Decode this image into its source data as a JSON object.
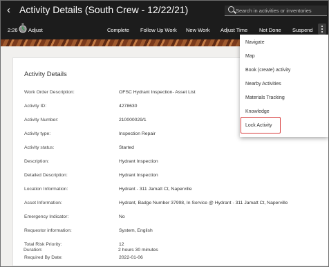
{
  "header": {
    "back_glyph": "‹",
    "title": "Activity Details (South Crew - 12/22/21)",
    "search_placeholder": "Search in activities or inventories",
    "time": "2:26",
    "adjust_label": "Adjust"
  },
  "toolbar": [
    {
      "name": "toolbar-complete",
      "label": "Complete"
    },
    {
      "name": "toolbar-follow-up-work",
      "label": "Follow Up Work"
    },
    {
      "name": "toolbar-new-work",
      "label": "New Work"
    },
    {
      "name": "toolbar-adjust-time",
      "label": "Adjust Time"
    },
    {
      "name": "toolbar-not-done",
      "label": "Not Done"
    },
    {
      "name": "toolbar-suspend",
      "label": "Suspend"
    }
  ],
  "menu": {
    "items": [
      "Navigate",
      "Map",
      "Book (create) activity",
      "Nearby Activities",
      "Materials Tracking",
      "Knowledge",
      "Lock Activity"
    ],
    "highlighted": "Lock Activity"
  },
  "card": {
    "title": "Activity Details",
    "rows": [
      {
        "label": "Work Order Description:",
        "value": "OFSC Hydrant Inspection- Asset List"
      },
      {
        "label": "Activity ID:",
        "value": "4278630"
      },
      {
        "label": "Activity Number:",
        "value": "210000029/1"
      },
      {
        "label": "Activity type:",
        "value": "Inspection Repair"
      },
      {
        "label": "Activity status:",
        "value": "Started"
      },
      {
        "label": "Description:",
        "value": "Hydrant Inspection"
      },
      {
        "label": "Detailed Description:",
        "value": "Hydrant Inspection"
      },
      {
        "label": "Location Information:",
        "value": "Hydrant - 311 Jamatt Ct, Naperville"
      },
      {
        "label": "Asset Information:",
        "value": "Hydrant, Badge Number 37998, In Service @ Hydrant - 311 Jamatt Ct, Naperville"
      },
      {
        "label": "Emergency Indicator:",
        "value": "No"
      },
      {
        "label": "Requestor information:",
        "value": "System, English"
      },
      {
        "label": "Total Risk Priority:",
        "value": "12"
      },
      {
        "label": "Required By Date:",
        "value": "2022-01-06"
      },
      {
        "label": "Duration:",
        "value": "2 hours 30 minutes"
      }
    ]
  },
  "colors": {
    "header_bg": "#1c1c1c",
    "highlight": "#d63a3a"
  }
}
